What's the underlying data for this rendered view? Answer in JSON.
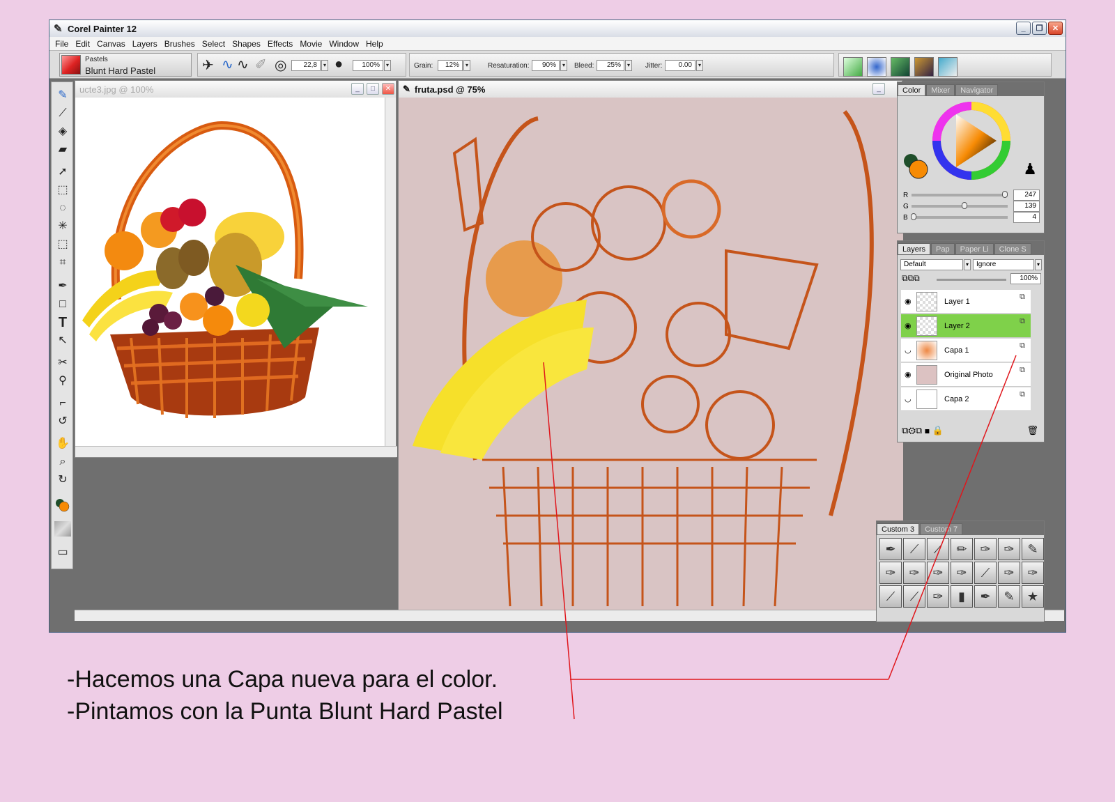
{
  "app": {
    "title": "Corel Painter 12",
    "window_buttons": [
      "_",
      "❐",
      "✕"
    ]
  },
  "menu": [
    "File",
    "Edit",
    "Canvas",
    "Layers",
    "Brushes",
    "Select",
    "Shapes",
    "Effects",
    "Movie",
    "Window",
    "Help"
  ],
  "property_bar": {
    "brush_category": "Pastels",
    "brush_variant": "Blunt Hard Pastel",
    "size": "22,8",
    "opacity": "100%",
    "grain_label": "Grain:",
    "grain": "12%",
    "resaturation_label": "Resaturation:",
    "resaturation": "90%",
    "bleed_label": "Bleed:",
    "bleed": "25%",
    "jitter_label": "Jitter:",
    "jitter": "0.00"
  },
  "documents": {
    "doc1_title": "ucte3.jpg @ 100%",
    "doc2_title": "fruta.psd @ 75%"
  },
  "color_panel": {
    "tabs": [
      "Color",
      "Mixer",
      "Navigator"
    ],
    "r_label": "R",
    "g_label": "G",
    "b_label": "B",
    "r": "247",
    "g": "139",
    "b": "4",
    "r_level": 0.97,
    "g_level": 0.55,
    "b_level": 0.02,
    "main_color": "#f78b04",
    "secondary_color": "#1f4e2a"
  },
  "layers_panel": {
    "tabs": [
      "Layers",
      "Pap",
      "Paper Li",
      "Clone S"
    ],
    "composite_method": "Default",
    "preserve_mode": "Ignore",
    "opacity": "100%",
    "layers": [
      {
        "name": "Layer 1",
        "visible": true,
        "selected": false
      },
      {
        "name": "Layer 2",
        "visible": true,
        "selected": true
      },
      {
        "name": "Capa 1",
        "visible": false,
        "selected": false
      },
      {
        "name": "Original Photo",
        "visible": true,
        "selected": false
      },
      {
        "name": "Capa 2",
        "visible": false,
        "selected": false
      }
    ]
  },
  "brush_panel": {
    "tabs": [
      "Custom 3",
      "Custom 7"
    ]
  },
  "captions": {
    "line1": "-Hacemos una Capa nueva para el color.",
    "line2": "-Pintamos con la Punta Blunt Hard Pastel"
  },
  "colors": {
    "background": "#eecde6",
    "selected_layer": "#7fd14a",
    "annotation_line": "#e0161c"
  }
}
